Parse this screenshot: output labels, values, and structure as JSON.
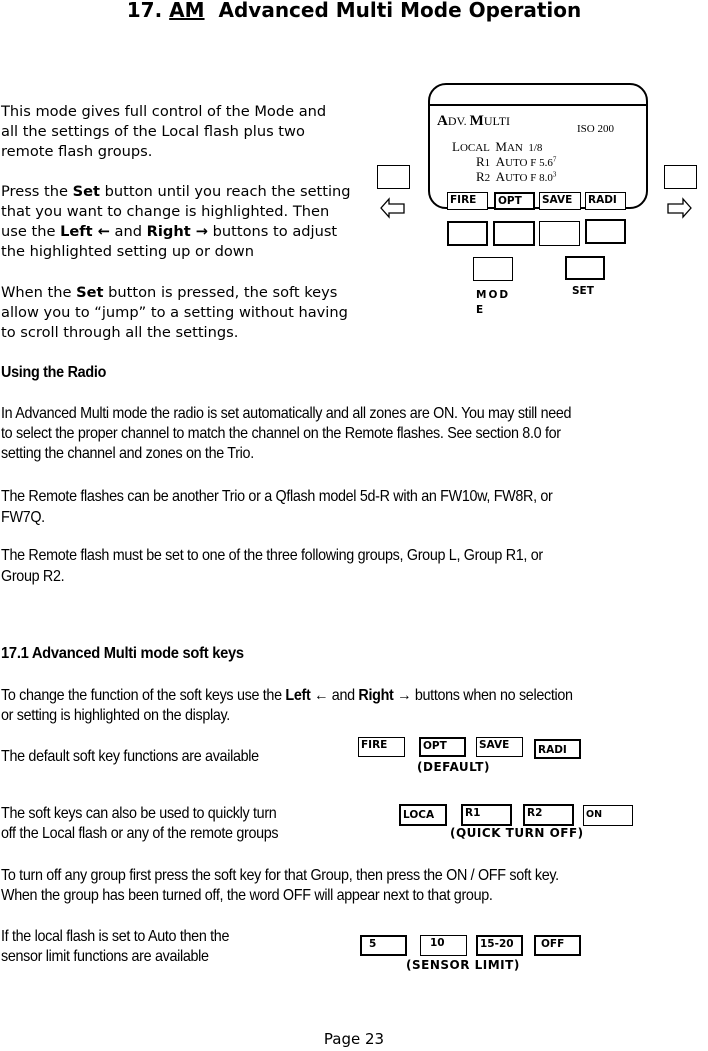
{
  "title": {
    "number": "17.",
    "abbrev": "AM",
    "text": "Advanced Multi Mode Operation"
  },
  "intro": {
    "p1": [
      "This mode gives full control of the Mode and",
      "all the settings of the Local flash plus two",
      "remote flash groups."
    ],
    "p2": {
      "l1_pre": "Press the ",
      "l1_bold": "Set",
      "l1_post": " button until you reach the setting",
      "l2": "that you want to change is highlighted. Then",
      "l3_pre": "use the ",
      "l3_bold1": "Left ←",
      "l3_mid": " and ",
      "l3_bold2": "Right →",
      "l3_post": " buttons to adjust",
      "l4": "the highlighted setting up or down"
    },
    "p3": {
      "l1_pre": "When the ",
      "l1_bold": "Set",
      "l1_post": " button is pressed, the soft keys",
      "l2": "allow you to “jump” to a setting without having",
      "l3": "to scroll through all the settings."
    }
  },
  "device": {
    "mode_name_a": "A",
    "mode_name_b": "DV. ",
    "mode_name_c": "M",
    "mode_name_d": "ULTI",
    "iso": "ISO 200",
    "local_label_a": "L",
    "local_label_b": "OCAL",
    "local_mode_a": "M",
    "local_mode_b": "AN",
    "local_value": "1/8",
    "r1_label_a": "R",
    "r1_label_b": "1",
    "r1_mode_a": "A",
    "r1_mode_b": "UTO",
    "r1_value": "F 5.6",
    "r1_sup": "7",
    "r2_label_a": "R",
    "r2_label_b": "2",
    "r2_mode_a": "A",
    "r2_mode_b": "UTO",
    "r2_value": "F 8.0",
    "r2_sup": "3",
    "softkeys": [
      "FIRE",
      "OPT",
      "SAVE",
      "RADI"
    ],
    "mode_button_label_1": "MOD",
    "mode_button_label_2": "E",
    "set_button_label": "SET",
    "left_arrow_icon": "left-arrow-icon",
    "right_arrow_icon": "right-arrow-icon"
  },
  "radio": {
    "heading": "Using the Radio",
    "p1": [
      "In Advanced Multi mode the radio is set automatically and all zones are ON.  You may still need",
      "to select the proper channel to match the channel on the Remote flashes.   See section 8.0 for",
      "setting the channel and zones on the Trio."
    ],
    "p2": [
      "The Remote flashes can be another Trio or a Qflash model 5d-R with an FW10w, FW8R, or",
      "FW7Q."
    ],
    "p3": [
      "The Remote flash must be set to one of the three following groups, Group L, Group R1, or",
      "Group R2."
    ]
  },
  "softkeys_section": {
    "heading": "17.1 Advanced Multi mode soft keys",
    "p1": {
      "l1_pre": "To change the function of the soft keys use the ",
      "l1_bold1": "Left ←",
      "l1_mid": " and ",
      "l1_bold2": "Right →",
      "l1_post": " buttons when no selection",
      "l2": "or setting is highlighted on the display."
    },
    "default_text": "The default soft key functions are available",
    "default_keys": [
      "FIRE",
      "OPT",
      "SAVE",
      "RADI"
    ],
    "default_caption": "(DEFAULT)",
    "quick_text": [
      "The soft keys can also be used to quickly turn",
      "off the Local flash or any of the remote groups"
    ],
    "quick_keys": [
      "LOCA",
      "R1",
      "R2",
      "ON"
    ],
    "quick_caption": "(QUICK TURN OFF)",
    "turnoff_text": [
      "To turn off any group first press the soft key for that Group, then press the ON / OFF soft key.",
      "When the group has been turned off, the word OFF will appear next to that group."
    ],
    "sensor_text": [
      "If the local flash is set to Auto then the",
      "sensor limit functions are available"
    ],
    "sensor_keys": [
      "5",
      "10",
      "15-20",
      "OFF"
    ],
    "sensor_caption": "(SENSOR LIMIT)"
  },
  "footer": {
    "page": "Page 23"
  }
}
